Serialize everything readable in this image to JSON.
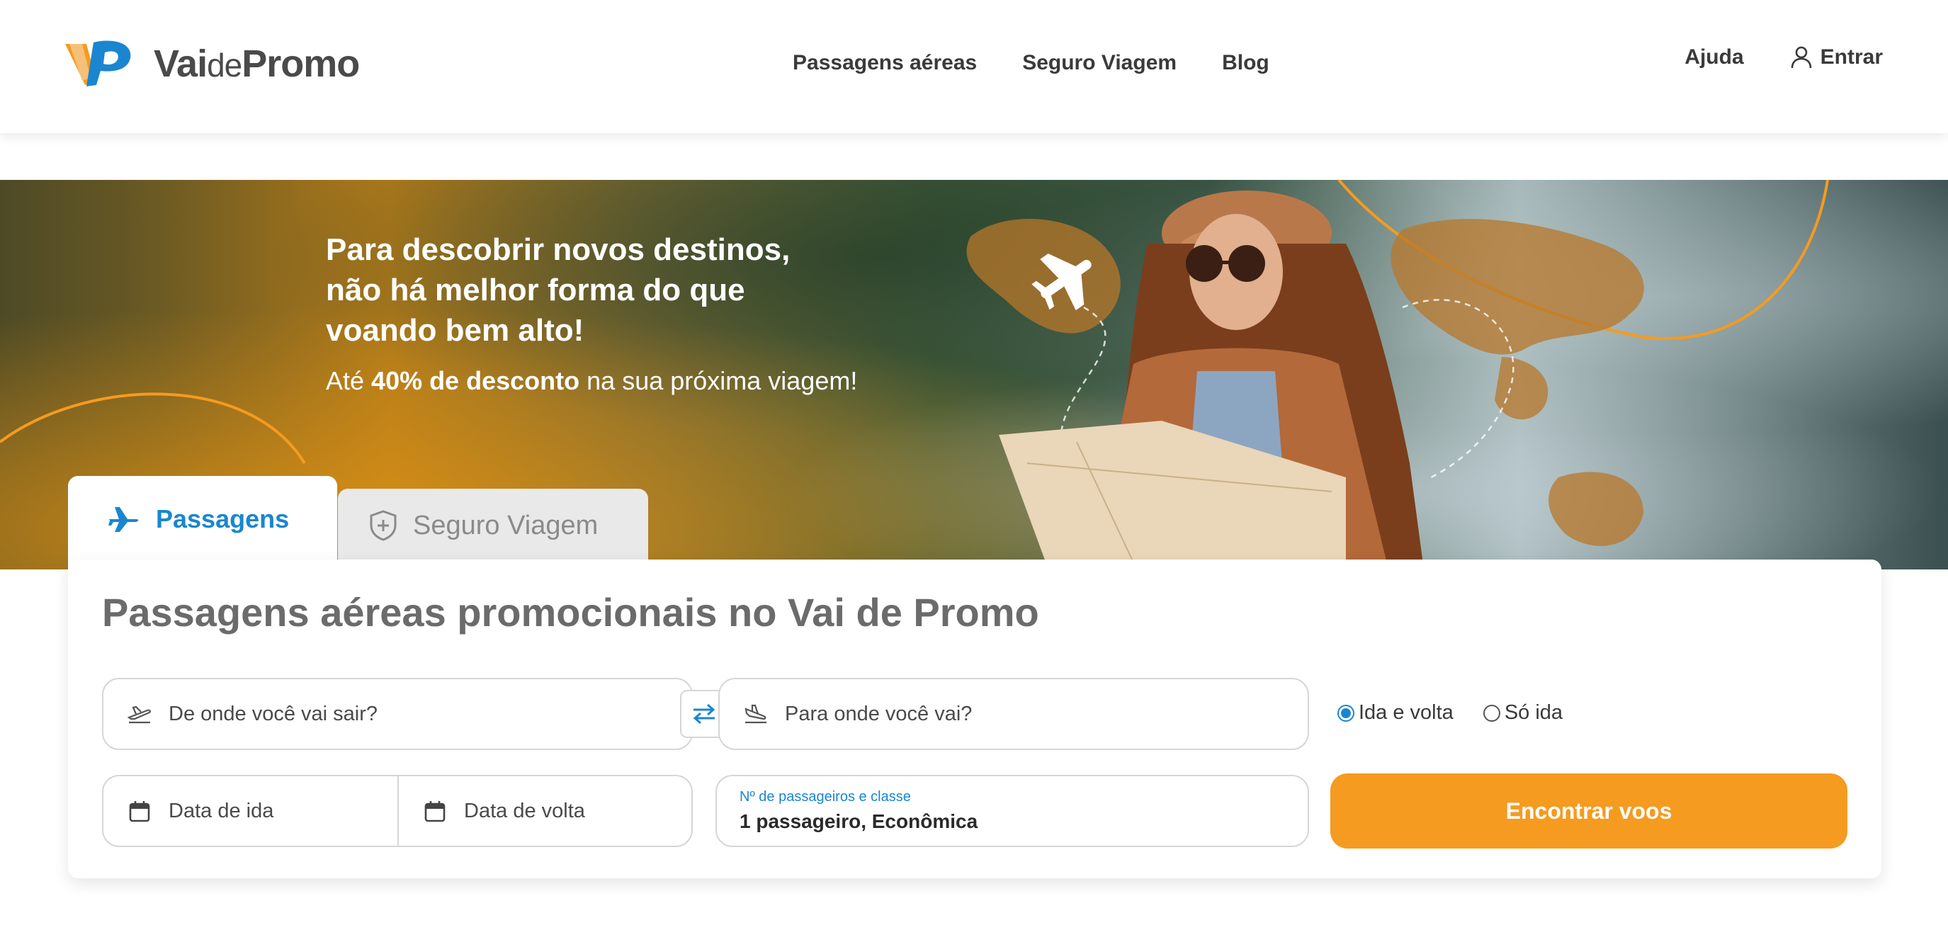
{
  "header": {
    "logo_text_vai": "Vai",
    "logo_text_de": "de",
    "logo_text_promo": "Promo",
    "nav": [
      "Passagens aéreas",
      "Seguro Viagem",
      "Blog"
    ],
    "help_label": "Ajuda",
    "login_label": "Entrar"
  },
  "hero": {
    "title_line1": "Para descobrir novos destinos,",
    "title_line2": "não há melhor forma do que",
    "title_line3": "voando bem alto!",
    "subtitle_prefix": "Até ",
    "subtitle_bold": "40% de desconto",
    "subtitle_suffix": " na sua próxima viagem!"
  },
  "tabs": {
    "active_label": "Passagens",
    "inactive_label": "Seguro Viagem"
  },
  "search": {
    "title": "Passagens aéreas promocionais no Vai de Promo",
    "origin_placeholder": "De onde você vai sair?",
    "destination_placeholder": "Para onde você vai?",
    "trip_type_options": [
      "Ida e volta",
      "Só ida"
    ],
    "trip_type_selected": "Ida e volta",
    "depart_date_placeholder": "Data de ida",
    "return_date_placeholder": "Data de volta",
    "passengers_label": "Nº de passageiros e classe",
    "passengers_value": "1 passageiro, Econômica",
    "submit_label": "Encontrar voos"
  },
  "colors": {
    "brand_orange": "#f59b1f",
    "brand_blue": "#1a86d0",
    "text_dark": "#3a3a3a"
  },
  "icons": [
    "logo-mark-icon",
    "user-icon",
    "airplane-icon",
    "shield-plus-icon",
    "takeoff-icon",
    "landing-icon",
    "swap-arrows-icon",
    "calendar-icon"
  ]
}
